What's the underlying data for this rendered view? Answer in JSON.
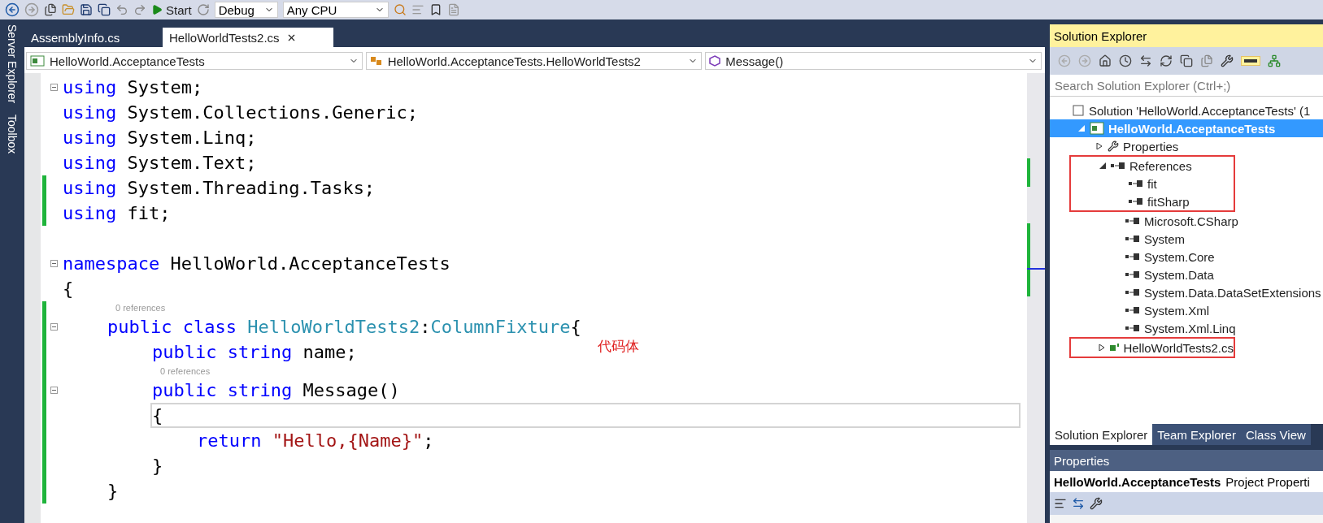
{
  "toolbar": {
    "start_label": "Start",
    "configuration": "Debug",
    "platform": "Any CPU"
  },
  "side_tabs": [
    "Server Explorer",
    "Toolbox"
  ],
  "editor_tabs": [
    {
      "label": "AssemblyInfo.cs",
      "selected": false
    },
    {
      "label": "HelloWorldTests2.cs",
      "selected": true
    }
  ],
  "nav_bar": [
    {
      "kind": "project",
      "text": "HelloWorld.AcceptanceTests"
    },
    {
      "kind": "class",
      "text": "HelloWorld.AcceptanceTests.HelloWorldTests2"
    },
    {
      "kind": "method",
      "text": "Message()"
    }
  ],
  "code": [
    {
      "kind": "code",
      "fold": true,
      "changed": false,
      "current": false,
      "tokens": [
        {
          "kind": "keyword",
          "text": "using"
        },
        {
          "kind": "plain",
          "text": " System;"
        }
      ]
    },
    {
      "kind": "code",
      "fold": false,
      "changed": false,
      "current": false,
      "tokens": [
        {
          "kind": "keyword",
          "text": "using"
        },
        {
          "kind": "plain",
          "text": " System.Collections.Generic;"
        }
      ]
    },
    {
      "kind": "code",
      "fold": false,
      "changed": false,
      "current": false,
      "tokens": [
        {
          "kind": "keyword",
          "text": "using"
        },
        {
          "kind": "plain",
          "text": " System.Linq;"
        }
      ]
    },
    {
      "kind": "code",
      "fold": false,
      "changed": false,
      "current": false,
      "tokens": [
        {
          "kind": "keyword",
          "text": "using"
        },
        {
          "kind": "plain",
          "text": " System.Text;"
        }
      ]
    },
    {
      "kind": "code",
      "fold": false,
      "changed": true,
      "current": false,
      "tokens": [
        {
          "kind": "keyword",
          "text": "using"
        },
        {
          "kind": "plain",
          "text": " System.Threading.Tasks;"
        }
      ]
    },
    {
      "kind": "code",
      "fold": false,
      "changed": true,
      "current": false,
      "tokens": [
        {
          "kind": "keyword",
          "text": "using"
        },
        {
          "kind": "plain",
          "text": " fit;"
        }
      ]
    },
    {
      "kind": "blank",
      "changed": false
    },
    {
      "kind": "code",
      "fold": true,
      "changed": false,
      "current": false,
      "tokens": [
        {
          "kind": "keyword",
          "text": "namespace"
        },
        {
          "kind": "plain",
          "text": " HelloWorld.AcceptanceTests"
        }
      ]
    },
    {
      "kind": "code",
      "fold": false,
      "changed": false,
      "current": false,
      "tokens": [
        {
          "kind": "plain",
          "text": "{"
        }
      ],
      "children": [
        {
          "kind": "lens",
          "changed": true,
          "text": "0 references"
        },
        {
          "kind": "code",
          "fold": true,
          "changed": true,
          "current": false,
          "tokens": [
            {
              "kind": "keyword",
              "text": "public"
            },
            {
              "kind": "keyword",
              "text": " class"
            },
            {
              "kind": "type",
              "text": " HelloWorldTests2"
            },
            {
              "kind": "plain",
              "text": ":"
            },
            {
              "kind": "type",
              "text": "ColumnFixture"
            },
            {
              "kind": "plain",
              "text": "{"
            }
          ],
          "children": [
            {
              "kind": "code",
              "fold": false,
              "changed": true,
              "current": false,
              "tokens": [
                {
                  "kind": "keyword",
                  "text": "public"
                },
                {
                  "kind": "keyword",
                  "text": " string"
                },
                {
                  "kind": "plain",
                  "text": " name;"
                }
              ]
            },
            {
              "kind": "lens",
              "changed": true,
              "text": "0 references"
            },
            {
              "kind": "code",
              "fold": true,
              "changed": true,
              "current": false,
              "tokens": [
                {
                  "kind": "keyword",
                  "text": "public"
                },
                {
                  "kind": "keyword",
                  "text": " string"
                },
                {
                  "kind": "plain",
                  "text": " Message()"
                }
              ]
            },
            {
              "kind": "code",
              "fold": false,
              "changed": true,
              "current": true,
              "tokens": [
                {
                  "kind": "plain",
                  "text": "{"
                }
              ],
              "children": [
                {
                  "kind": "code",
                  "fold": false,
                  "changed": true,
                  "current": false,
                  "tokens": [
                    {
                      "kind": "keyword",
                      "text": "return"
                    },
                    {
                      "kind": "string",
                      "text": " \"Hello,{Name}\""
                    },
                    {
                      "kind": "plain",
                      "text": ";"
                    }
                  ]
                }
              ]
            },
            {
              "kind": "code",
              "fold": false,
              "changed": true,
              "current": false,
              "tokens": [
                {
                  "kind": "plain",
                  "text": "}"
                }
              ]
            }
          ]
        },
        {
          "kind": "code",
          "fold": false,
          "changed": true,
          "current": false,
          "tokens": [
            {
              "kind": "plain",
              "text": "}"
            }
          ]
        }
      ]
    }
  ],
  "annotation": "代码体",
  "solution_explorer": {
    "title": "Solution Explorer",
    "preview_on": true,
    "search": {
      "placeholder": "Search Solution Explorer (Ctrl+;)"
    },
    "tree": [
      {
        "kind": "solution",
        "label": "Solution 'HelloWorld.AcceptanceTests' (1",
        "selected": false,
        "boxed": false,
        "children": [
          {
            "kind": "project",
            "label": "HelloWorld.AcceptanceTests",
            "selected": true,
            "boxed": false,
            "expanded": true,
            "children": [
              {
                "kind": "properties",
                "label": "Properties",
                "selected": false,
                "boxed": false,
                "expanded": false
              },
              {
                "kind": "references",
                "label": "References",
                "selected": false,
                "boxed": true,
                "expanded": true,
                "children": [
                  {
                    "kind": "reference",
                    "label": "fit",
                    "selected": false,
                    "boxed": true
                  },
                  {
                    "kind": "reference",
                    "label": "fitSharp",
                    "selected": false,
                    "boxed": true
                  },
                  {
                    "kind": "reference",
                    "label": "Microsoft.CSharp",
                    "selected": false,
                    "boxed": false
                  },
                  {
                    "kind": "reference",
                    "label": "System",
                    "selected": false,
                    "boxed": false
                  },
                  {
                    "kind": "reference",
                    "label": "System.Core",
                    "selected": false,
                    "boxed": false
                  },
                  {
                    "kind": "reference",
                    "label": "System.Data",
                    "selected": false,
                    "boxed": false
                  },
                  {
                    "kind": "reference",
                    "label": "System.Data.DataSetExtensions",
                    "selected": false,
                    "boxed": false
                  },
                  {
                    "kind": "reference",
                    "label": "System.Xml",
                    "selected": false,
                    "boxed": false
                  },
                  {
                    "kind": "reference",
                    "label": "System.Xml.Linq",
                    "selected": false,
                    "boxed": false
                  }
                ]
              },
              {
                "kind": "csfile",
                "label": "HelloWorldTests2.cs",
                "selected": false,
                "boxed": true,
                "expanded": false
              }
            ]
          }
        ]
      }
    ],
    "bottom_tabs": [
      {
        "label": "Solution Explorer",
        "selected": true
      },
      {
        "label": "Team Explorer",
        "selected": false
      },
      {
        "label": "Class View",
        "selected": false
      }
    ]
  },
  "properties": {
    "title": "Properties",
    "object_name": "HelloWorld.AcceptanceTests",
    "object_type": "Project Properti"
  }
}
